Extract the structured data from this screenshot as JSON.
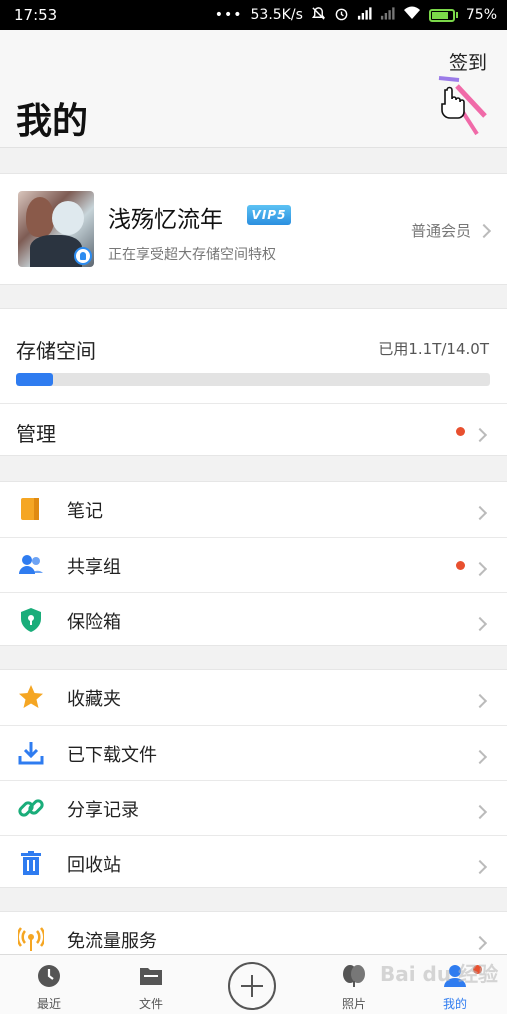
{
  "status_bar": {
    "time": "17:53",
    "dots": "•••",
    "speed": "53.5K/s",
    "battery": "75%"
  },
  "header": {
    "title": "我的",
    "checkin_label": "签到"
  },
  "profile": {
    "username": "浅殇忆流年",
    "vip_badge": "VIP5",
    "subtitle": "正在享受超大存储空间特权",
    "member_label": "普通会员"
  },
  "storage": {
    "label": "存储空间",
    "used_text": "已用1.1T/14.0T",
    "used_fraction": 0.0786,
    "manage_label": "管理"
  },
  "group1": [
    {
      "label": "笔记",
      "icon": "notebook-icon",
      "dot": false
    },
    {
      "label": "共享组",
      "icon": "group-icon",
      "dot": true
    },
    {
      "label": "保险箱",
      "icon": "shield-icon",
      "dot": false
    }
  ],
  "group2": [
    {
      "label": "收藏夹",
      "icon": "star-icon"
    },
    {
      "label": "已下载文件",
      "icon": "download-icon"
    },
    {
      "label": "分享记录",
      "icon": "link-icon"
    },
    {
      "label": "回收站",
      "icon": "trash-icon"
    }
  ],
  "group3": [
    {
      "label": "免流量服务",
      "icon": "signal-icon"
    }
  ],
  "tabs": [
    {
      "label": "最近",
      "icon": "clock-icon"
    },
    {
      "label": "文件",
      "icon": "folder-icon"
    },
    {
      "label": "照片",
      "icon": "photo-icon"
    },
    {
      "label": "我的",
      "icon": "person-icon",
      "active": true
    }
  ],
  "watermark": "Bai du 经验",
  "colors": {
    "accent": "#2f7cf0",
    "dot": "#e8502f",
    "vip": "#2b8fe0"
  }
}
